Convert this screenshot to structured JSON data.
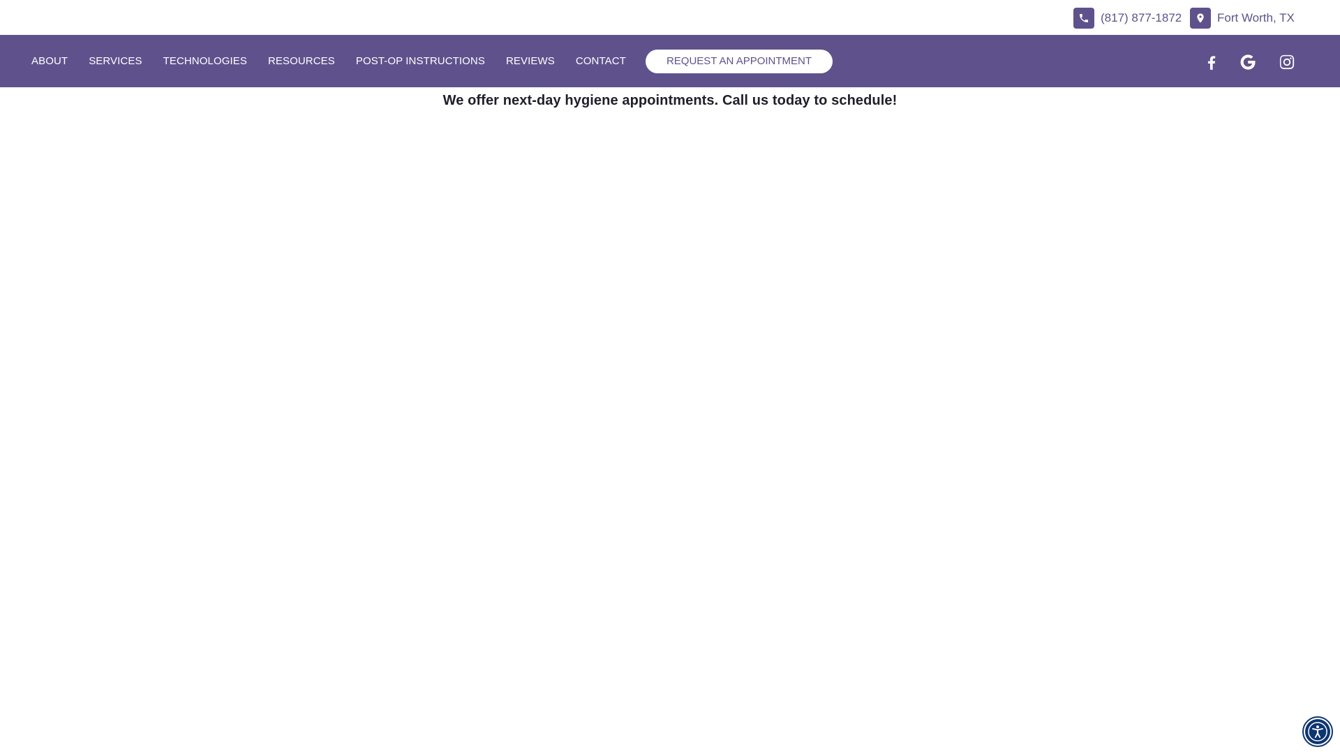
{
  "colors": {
    "brand_purple": "#5f528c",
    "white": "#ffffff",
    "announcement_text": "#1f1f2a",
    "a11y_navy": "#0d3570"
  },
  "topbar": {
    "phone": {
      "icon": "phone-icon",
      "text": "(817) 877-1872"
    },
    "location": {
      "icon": "map-pin-icon",
      "text": "Fort Worth, TX"
    }
  },
  "nav": {
    "items": [
      {
        "label": "ABOUT"
      },
      {
        "label": "SERVICES"
      },
      {
        "label": "TECHNOLOGIES"
      },
      {
        "label": "RESOURCES"
      },
      {
        "label": "POST-OP INSTRUCTIONS"
      },
      {
        "label": "REVIEWS"
      },
      {
        "label": "CONTACT"
      }
    ],
    "cta_label": "REQUEST AN APPOINTMENT",
    "social": [
      {
        "icon": "facebook-icon"
      },
      {
        "icon": "google-icon"
      },
      {
        "icon": "instagram-icon"
      }
    ]
  },
  "announcement": {
    "text": "We offer next-day hygiene appointments. Call us today to schedule!"
  },
  "accessibility": {
    "icon": "accessibility-icon"
  }
}
